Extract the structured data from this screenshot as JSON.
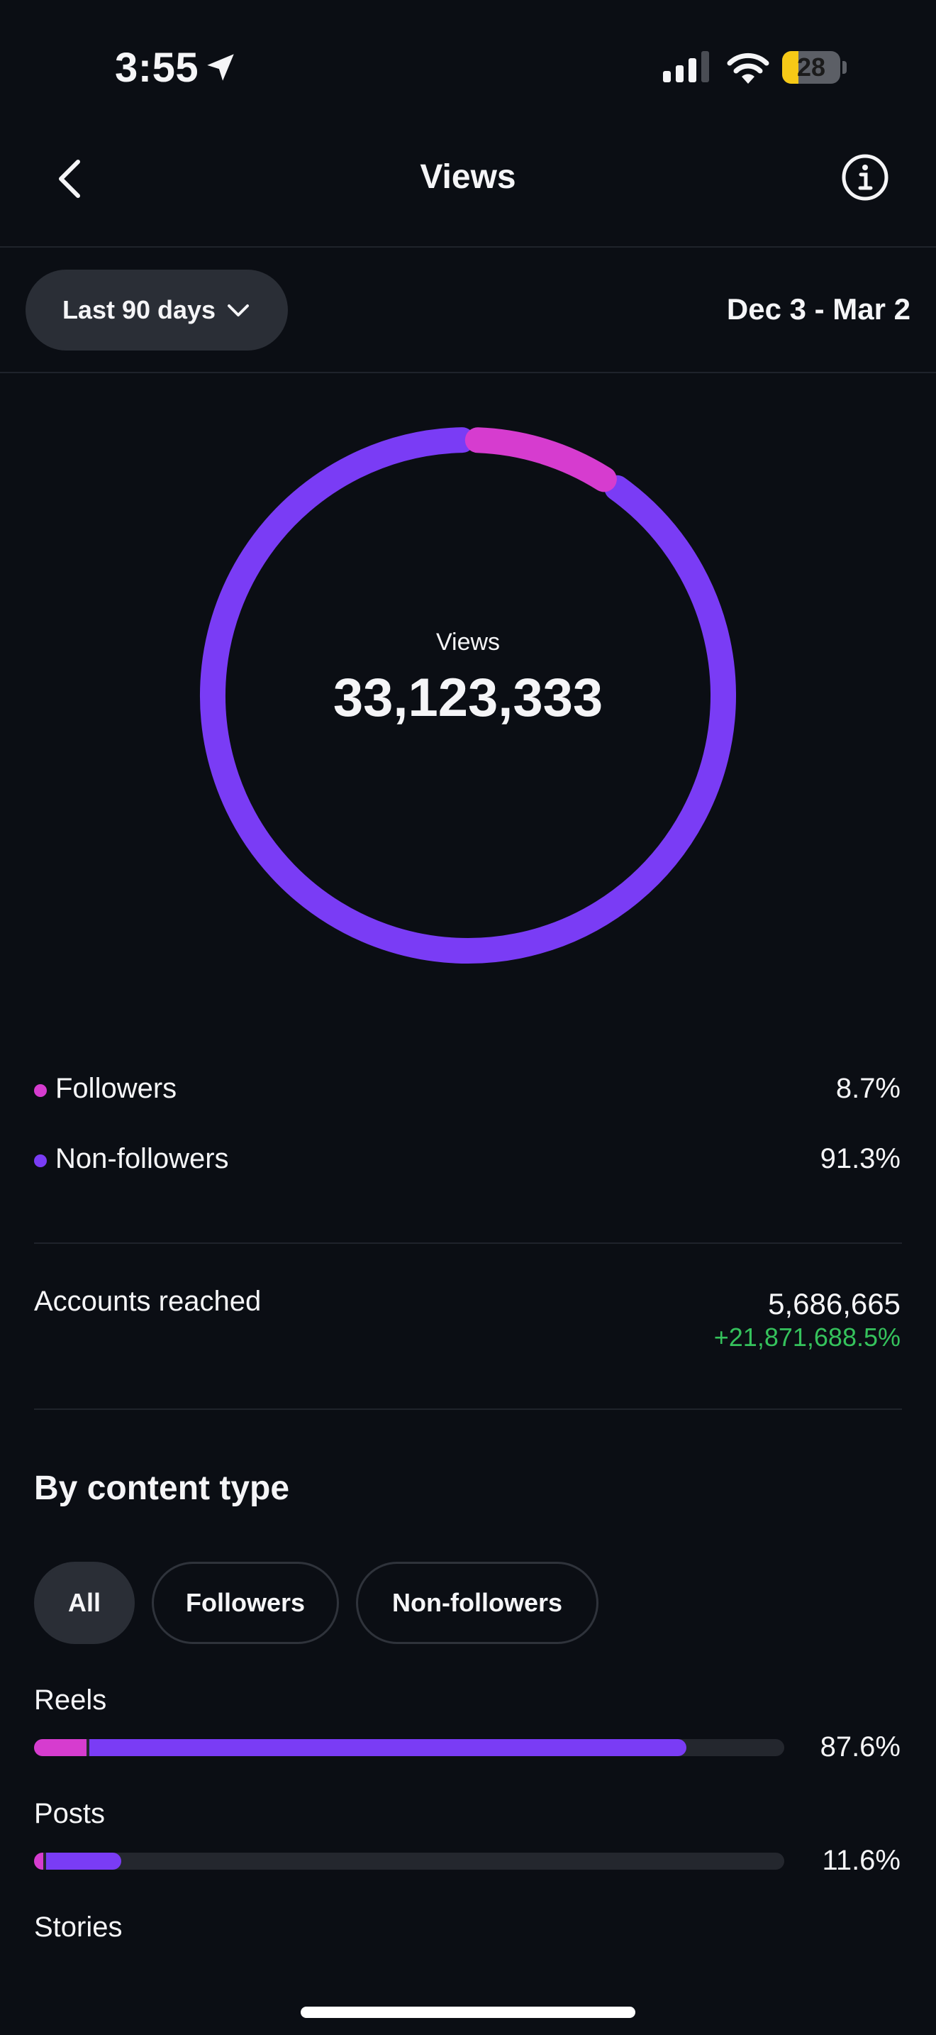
{
  "status_bar": {
    "time": "3:55",
    "battery": "28",
    "battery_level": 0.28
  },
  "nav": {
    "title": "Views",
    "back_icon": "chevron-left-icon",
    "info_icon": "info-icon"
  },
  "filter": {
    "range_label": "Last 90 days",
    "date_range": "Dec 3 - Mar 2"
  },
  "donut": {
    "label": "Views",
    "value": "33,123,333",
    "followers_pct": 8.7,
    "non_followers_pct": 91.3
  },
  "legend": [
    {
      "label": "Followers",
      "value": "8.7%",
      "color": "#d63ccf"
    },
    {
      "label": "Non-followers",
      "value": "91.3%",
      "color": "#7a3cf5"
    }
  ],
  "reach": {
    "label": "Accounts reached",
    "value": "5,686,665",
    "delta": "+21,871,688.5%"
  },
  "content_type": {
    "title": "By content type",
    "chips": [
      "All",
      "Followers",
      "Non-followers"
    ],
    "active_chip": "All",
    "rows": [
      {
        "label": "Reels",
        "pct": "87.6%",
        "followers_frac": 0.07,
        "non_followers_frac": 0.8
      },
      {
        "label": "Posts",
        "pct": "11.6%",
        "followers_frac": 0.012,
        "non_followers_frac": 0.104
      },
      {
        "label": "Stories"
      }
    ]
  },
  "colors": {
    "background": "#0b0e14",
    "followers": "#d63ccf",
    "non_followers": "#7a3cf5",
    "positive": "#35c25c"
  }
}
